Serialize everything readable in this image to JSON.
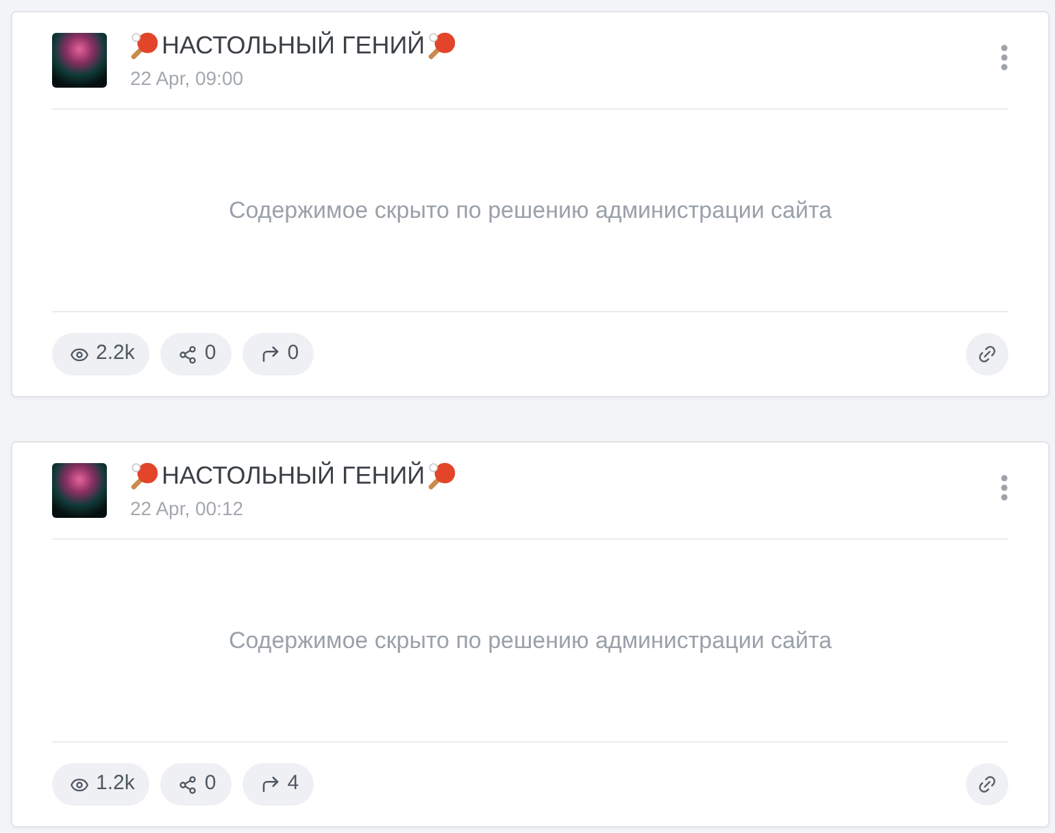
{
  "posts": [
    {
      "channel": {
        "name": "НАСТОЛЬНЫЙ ГЕНИЙ"
      },
      "date": "22 Apr, 09:00",
      "notice": "Содержимое скрыто по решению администрации сайта",
      "stats": [
        {
          "kind": "views",
          "value": "2.2k"
        },
        {
          "kind": "shares",
          "value": "0"
        },
        {
          "kind": "reposts",
          "value": "0"
        }
      ]
    },
    {
      "channel": {
        "name": "НАСТОЛЬНЫЙ ГЕНИЙ"
      },
      "date": "22 Apr, 00:12",
      "notice": "Содержимое скрыто по решению администрации сайта",
      "stats": [
        {
          "kind": "views",
          "value": "1.2k"
        },
        {
          "kind": "shares",
          "value": "0"
        },
        {
          "kind": "reposts",
          "value": "4"
        }
      ]
    }
  ]
}
